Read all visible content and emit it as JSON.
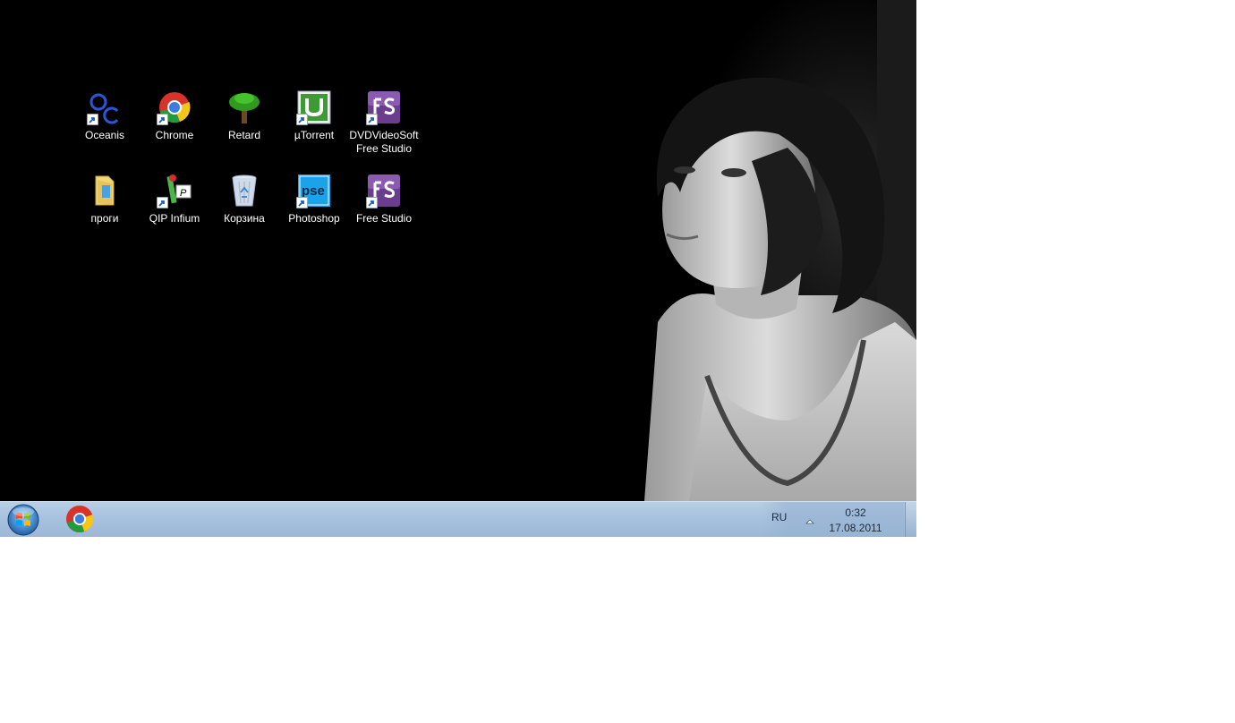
{
  "desktop": {
    "icons": [
      {
        "label": "Oceanis",
        "icon": "oceanis-icon"
      },
      {
        "label": "Chrome",
        "icon": "chrome-icon"
      },
      {
        "label": "Retard",
        "icon": "tree-icon"
      },
      {
        "label": "µTorrent",
        "icon": "utorrent-icon"
      },
      {
        "label": "DVDVideoSoft Free Studio",
        "icon": "free-studio-icon"
      },
      {
        "label": "проги",
        "icon": "folder-icon"
      },
      {
        "label": "QIP Infium",
        "icon": "qip-icon"
      },
      {
        "label": "Корзина",
        "icon": "recycle-bin-icon"
      },
      {
        "label": "Photoshop",
        "icon": "photoshop-icon"
      },
      {
        "label": "Free Studio",
        "icon": "free-studio-icon"
      }
    ]
  },
  "taskbar": {
    "start_icon": "windows-orb-icon",
    "pinned": [
      {
        "icon": "chrome-icon"
      }
    ],
    "tray": {
      "language": "RU",
      "time": "0:32",
      "date": "17.08.2011"
    }
  }
}
